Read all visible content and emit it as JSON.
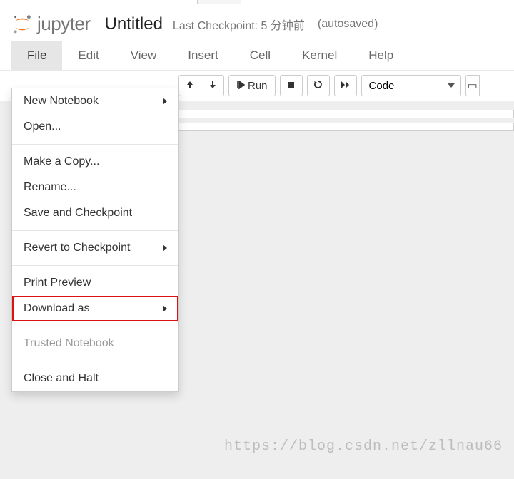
{
  "header": {
    "logo_text": "jupyter",
    "title": "Untitled",
    "checkpoint_label": "Last Checkpoint: 5 分钟前",
    "autosaved": "(autosaved)"
  },
  "menubar": {
    "items": [
      "File",
      "Edit",
      "View",
      "Insert",
      "Cell",
      "Kernel",
      "Help"
    ],
    "active_index": 0
  },
  "toolbar": {
    "run_label": "Run",
    "cell_type": "Code"
  },
  "file_menu": {
    "items": [
      {
        "label": "New Notebook",
        "submenu": true
      },
      {
        "label": "Open..."
      },
      {
        "divider": true
      },
      {
        "label": "Make a Copy..."
      },
      {
        "label": "Rename..."
      },
      {
        "label": "Save and Checkpoint"
      },
      {
        "divider": true
      },
      {
        "label": "Revert to Checkpoint",
        "submenu": true
      },
      {
        "divider": true
      },
      {
        "label": "Print Preview"
      },
      {
        "label": "Download as",
        "submenu": true,
        "highlighted": true
      },
      {
        "divider": true
      },
      {
        "label": "Trusted Notebook",
        "disabled": true
      },
      {
        "divider": true
      },
      {
        "label": "Close and Halt"
      }
    ]
  },
  "watermark": "https://blog.csdn.net/zllnau66"
}
